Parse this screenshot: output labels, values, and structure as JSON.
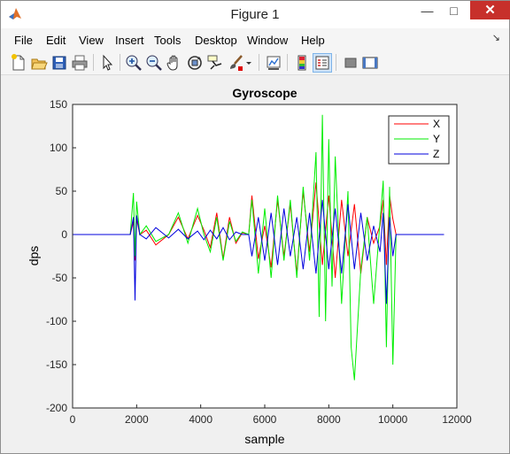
{
  "window": {
    "title": "Figure 1",
    "minimize_icon": "minimize-icon",
    "maximize_icon": "maximize-icon",
    "close_icon": "close-icon"
  },
  "menubar": {
    "items": [
      "File",
      "Edit",
      "View",
      "Insert",
      "Tools",
      "Desktop",
      "Window",
      "Help"
    ]
  },
  "toolbar": {
    "icons": [
      "new-figure-icon",
      "open-file-icon",
      "save-icon",
      "print-icon",
      "edit-plot-arrow-icon",
      "zoom-in-icon",
      "zoom-out-icon",
      "pan-hand-icon",
      "rotate-3d-icon",
      "data-cursor-icon",
      "brush-icon",
      "link-plot-icon",
      "insert-colorbar-icon",
      "insert-legend-icon",
      "hide-plot-tools-icon",
      "show-plot-tools-icon"
    ]
  },
  "chart_data": {
    "type": "line",
    "title": "Gyroscope",
    "xlabel": "sample",
    "ylabel": "dps",
    "xlim": [
      0,
      12000
    ],
    "ylim": [
      -200,
      150
    ],
    "x_ticks": [
      "0",
      "2000",
      "4000",
      "6000",
      "8000",
      "10000",
      "12000"
    ],
    "y_ticks": [
      "150",
      "100",
      "50",
      "0",
      "-50",
      "-100",
      "-150",
      "-200"
    ],
    "legend_position": "top-right",
    "grid": false,
    "series": [
      {
        "name": "X",
        "color": "#ff0000",
        "x": [
          0,
          1800,
          1900,
          1950,
          2000,
          2100,
          2300,
          2600,
          3000,
          3300,
          3600,
          3900,
          4100,
          4300,
          4500,
          4700,
          4900,
          5100,
          5300,
          5500,
          5600,
          5800,
          6000,
          6200,
          6400,
          6600,
          6800,
          7000,
          7200,
          7400,
          7600,
          7800,
          8000,
          8200,
          8400,
          8600,
          8800,
          9000,
          9200,
          9400,
          9600,
          9700,
          9800,
          9900,
          10000,
          10100,
          11600
        ],
        "values": [
          0,
          0,
          15,
          -30,
          18,
          0,
          5,
          -12,
          0,
          20,
          -5,
          22,
          5,
          -15,
          25,
          -28,
          20,
          -10,
          2,
          0,
          45,
          -28,
          10,
          -38,
          40,
          -25,
          35,
          -45,
          50,
          -20,
          60,
          -35,
          45,
          -50,
          40,
          -25,
          35,
          -45,
          20,
          -10,
          10,
          40,
          -35,
          45,
          18,
          0,
          0
        ]
      },
      {
        "name": "Y",
        "color": "#00ee00",
        "x": [
          0,
          1800,
          1900,
          1950,
          2000,
          2100,
          2300,
          2600,
          3000,
          3300,
          3600,
          3900,
          4100,
          4300,
          4500,
          4700,
          4900,
          5100,
          5300,
          5500,
          5600,
          5800,
          6000,
          6200,
          6400,
          6600,
          6800,
          7000,
          7200,
          7400,
          7600,
          7700,
          7800,
          7900,
          8000,
          8100,
          8200,
          8400,
          8600,
          8700,
          8800,
          9000,
          9200,
          9400,
          9600,
          9700,
          9800,
          9900,
          10000,
          10100,
          11600
        ],
        "values": [
          0,
          0,
          48,
          -25,
          38,
          0,
          10,
          -8,
          0,
          25,
          -10,
          30,
          0,
          -20,
          20,
          -30,
          15,
          -8,
          3,
          0,
          40,
          -45,
          30,
          -50,
          45,
          -30,
          40,
          -50,
          55,
          -30,
          95,
          -95,
          138,
          -100,
          110,
          -60,
          90,
          -80,
          50,
          -130,
          -168,
          -40,
          20,
          -80,
          15,
          62,
          -130,
          55,
          -150,
          0,
          0
        ]
      },
      {
        "name": "Z",
        "color": "#0000dd",
        "x": [
          0,
          1800,
          1900,
          1950,
          2000,
          2100,
          2300,
          2600,
          3000,
          3300,
          3600,
          3900,
          4100,
          4300,
          4500,
          4700,
          4900,
          5100,
          5300,
          5500,
          5600,
          5800,
          6000,
          6200,
          6400,
          6600,
          6800,
          7000,
          7200,
          7400,
          7600,
          7800,
          8000,
          8200,
          8400,
          8600,
          8800,
          9000,
          9200,
          9400,
          9600,
          9700,
          9800,
          9900,
          10000,
          10100,
          11600
        ],
        "values": [
          0,
          0,
          20,
          -76,
          22,
          0,
          -5,
          8,
          -4,
          6,
          -5,
          4,
          -6,
          5,
          -5,
          8,
          -6,
          3,
          0,
          0,
          -25,
          20,
          -30,
          25,
          -35,
          30,
          -25,
          20,
          -40,
          25,
          -45,
          40,
          -40,
          30,
          -45,
          35,
          -40,
          25,
          -30,
          10,
          -20,
          25,
          -80,
          20,
          -25,
          0,
          0
        ]
      }
    ]
  }
}
